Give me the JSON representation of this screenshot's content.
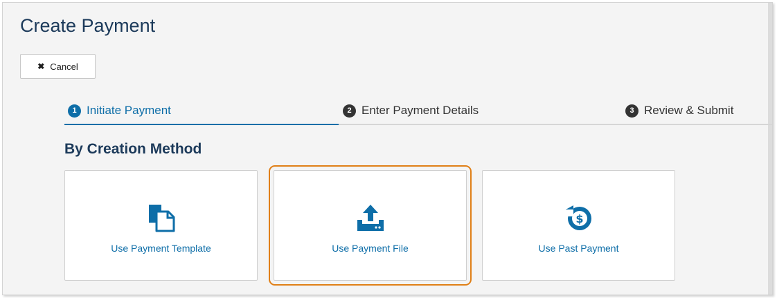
{
  "page": {
    "title": "Create Payment"
  },
  "toolbar": {
    "cancel_label": "Cancel",
    "cancel_icon": "close-icon"
  },
  "steps": [
    {
      "number": "1",
      "label": "Initiate Payment",
      "active": true
    },
    {
      "number": "2",
      "label": "Enter Payment Details",
      "active": false
    },
    {
      "number": "3",
      "label": "Review & Submit",
      "active": false
    }
  ],
  "section": {
    "title": "By Creation Method"
  },
  "cards": [
    {
      "label": "Use Payment Template",
      "icon": "document-copy-icon",
      "selected": false
    },
    {
      "label": "Use Payment File",
      "icon": "upload-icon",
      "selected": true
    },
    {
      "label": "Use Past Payment",
      "icon": "history-dollar-icon",
      "selected": false
    }
  ],
  "colors": {
    "accent": "#0e6ea8",
    "title": "#1c3a5a",
    "selection_outline": "#e07f16"
  }
}
